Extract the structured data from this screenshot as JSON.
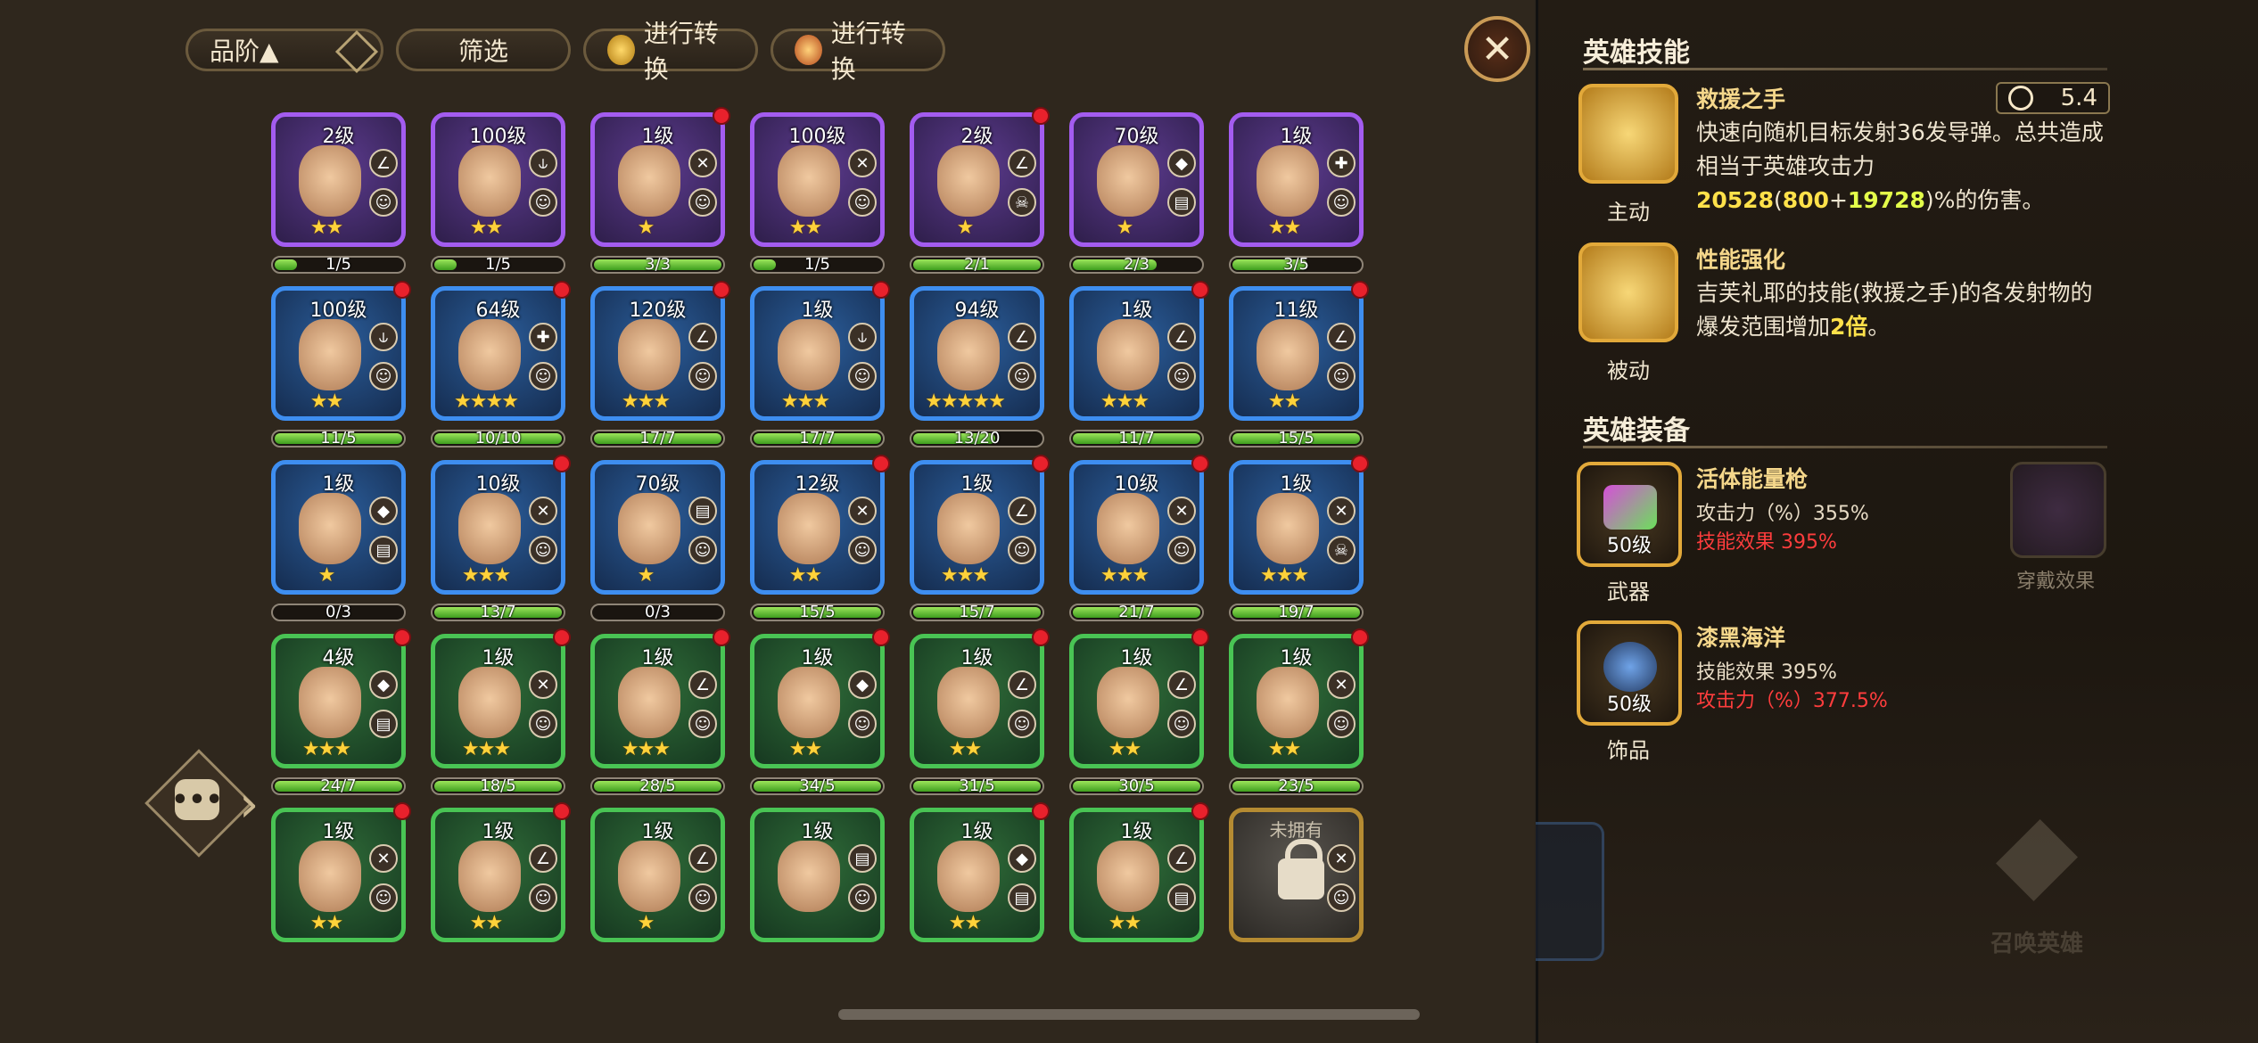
{
  "toolbar": {
    "sort_label": "品阶▲",
    "filter_label": "筛选",
    "convert1_label": "进行转换",
    "convert2_label": "进行转换"
  },
  "close_label": "✕",
  "heroes": [
    [
      {
        "level": "2级",
        "rarity": "purple",
        "stars": "★★",
        "progress": "1/5",
        "fill": 0.2,
        "dot": false,
        "badges": [
          "∠",
          "☺"
        ]
      },
      {
        "level": "100级",
        "rarity": "purple",
        "stars": "★★",
        "progress": "1/5",
        "fill": 0.2,
        "dot": false,
        "badges": [
          "⫝",
          "☺"
        ]
      },
      {
        "level": "1级",
        "rarity": "purple",
        "stars": "★",
        "progress": "3/3",
        "fill": 1.0,
        "dot": true,
        "badges": [
          "✕",
          "☺"
        ]
      },
      {
        "level": "100级",
        "rarity": "purple",
        "stars": "★★",
        "progress": "1/5",
        "fill": 0.2,
        "dot": false,
        "badges": [
          "✕",
          "☺"
        ]
      },
      {
        "level": "2级",
        "rarity": "purple",
        "stars": "★",
        "progress": "2/1",
        "fill": 1.0,
        "dot": true,
        "badges": [
          "∠",
          "☠"
        ]
      },
      {
        "level": "70级",
        "rarity": "purple",
        "stars": "★",
        "progress": "2/3",
        "fill": 0.67,
        "dot": false,
        "badges": [
          "◆",
          "▤"
        ]
      },
      {
        "level": "1级",
        "rarity": "purple",
        "stars": "★★",
        "progress": "3/5",
        "fill": 0.6,
        "dot": false,
        "badges": [
          "✚",
          "☺"
        ]
      }
    ],
    [
      {
        "level": "100级",
        "rarity": "blue",
        "stars": "★★",
        "progress": "11/5",
        "fill": 1.0,
        "dot": true,
        "badges": [
          "⫝",
          "☺"
        ]
      },
      {
        "level": "64级",
        "rarity": "blue",
        "stars": "★★★★",
        "progress": "10/10",
        "fill": 1.0,
        "dot": true,
        "badges": [
          "✚",
          "☺"
        ]
      },
      {
        "level": "120级",
        "rarity": "blue",
        "stars": "★★★",
        "progress": "17/7",
        "fill": 1.0,
        "dot": true,
        "badges": [
          "∠",
          "☺"
        ]
      },
      {
        "level": "1级",
        "rarity": "blue",
        "stars": "★★★",
        "progress": "17/7",
        "fill": 1.0,
        "dot": true,
        "badges": [
          "⫝",
          "☺"
        ]
      },
      {
        "level": "94级",
        "rarity": "blue",
        "stars": "★★★★★",
        "progress": "13/20",
        "fill": 0.65,
        "dot": false,
        "badges": [
          "∠",
          "☺"
        ]
      },
      {
        "level": "1级",
        "rarity": "blue",
        "stars": "★★★",
        "progress": "11/7",
        "fill": 1.0,
        "dot": true,
        "badges": [
          "∠",
          "☺"
        ]
      },
      {
        "level": "11级",
        "rarity": "blue",
        "stars": "★★",
        "progress": "15/5",
        "fill": 1.0,
        "dot": true,
        "badges": [
          "∠",
          "☺"
        ]
      }
    ],
    [
      {
        "level": "1级",
        "rarity": "blue",
        "stars": "★",
        "progress": "0/3",
        "fill": 0.0,
        "dot": false,
        "badges": [
          "◆",
          "▤"
        ]
      },
      {
        "level": "10级",
        "rarity": "blue",
        "stars": "★★★",
        "progress": "13/7",
        "fill": 1.0,
        "dot": true,
        "badges": [
          "✕",
          "☺"
        ]
      },
      {
        "level": "70级",
        "rarity": "blue",
        "stars": "★",
        "progress": "0/3",
        "fill": 0.0,
        "dot": false,
        "badges": [
          "▤",
          "☺"
        ]
      },
      {
        "level": "12级",
        "rarity": "blue",
        "stars": "★★",
        "progress": "15/5",
        "fill": 1.0,
        "dot": true,
        "badges": [
          "✕",
          "☺"
        ]
      },
      {
        "level": "1级",
        "rarity": "blue",
        "stars": "★★★",
        "progress": "15/7",
        "fill": 1.0,
        "dot": true,
        "badges": [
          "∠",
          "☺"
        ]
      },
      {
        "level": "10级",
        "rarity": "blue",
        "stars": "★★★",
        "progress": "21/7",
        "fill": 1.0,
        "dot": true,
        "badges": [
          "✕",
          "☺"
        ]
      },
      {
        "level": "1级",
        "rarity": "blue",
        "stars": "★★★",
        "progress": "19/7",
        "fill": 1.0,
        "dot": true,
        "badges": [
          "✕",
          "☠"
        ]
      }
    ],
    [
      {
        "level": "4级",
        "rarity": "green",
        "stars": "★★★",
        "progress": "24/7",
        "fill": 1.0,
        "dot": true,
        "badges": [
          "◆",
          "▤"
        ]
      },
      {
        "level": "1级",
        "rarity": "green",
        "stars": "★★★",
        "progress": "18/5",
        "fill": 1.0,
        "dot": true,
        "badges": [
          "✕",
          "☺"
        ]
      },
      {
        "level": "1级",
        "rarity": "green",
        "stars": "★★★",
        "progress": "28/5",
        "fill": 1.0,
        "dot": true,
        "badges": [
          "∠",
          "☺"
        ]
      },
      {
        "level": "1级",
        "rarity": "green",
        "stars": "★★",
        "progress": "34/5",
        "fill": 1.0,
        "dot": true,
        "badges": [
          "◆",
          "☺"
        ]
      },
      {
        "level": "1级",
        "rarity": "green",
        "stars": "★★",
        "progress": "31/5",
        "fill": 1.0,
        "dot": true,
        "badges": [
          "∠",
          "☺"
        ]
      },
      {
        "level": "1级",
        "rarity": "green",
        "stars": "★★",
        "progress": "30/5",
        "fill": 1.0,
        "dot": true,
        "badges": [
          "∠",
          "☺"
        ]
      },
      {
        "level": "1级",
        "rarity": "green",
        "stars": "★★",
        "progress": "23/5",
        "fill": 1.0,
        "dot": true,
        "badges": [
          "✕",
          "☺"
        ]
      }
    ],
    [
      {
        "level": "1级",
        "rarity": "green",
        "stars": "★★",
        "progress": "",
        "fill": 0,
        "dot": true,
        "badges": [
          "✕",
          "☺"
        ]
      },
      {
        "level": "1级",
        "rarity": "green",
        "stars": "★★",
        "progress": "",
        "fill": 0,
        "dot": true,
        "badges": [
          "∠",
          "☺"
        ]
      },
      {
        "level": "1级",
        "rarity": "green",
        "stars": "★",
        "progress": "",
        "fill": 0,
        "dot": false,
        "badges": [
          "∠",
          "☺"
        ]
      },
      {
        "level": "1级",
        "rarity": "green",
        "stars": "",
        "progress": "",
        "fill": 0,
        "dot": false,
        "badges": [
          "▤",
          "☺"
        ]
      },
      {
        "level": "1级",
        "rarity": "green",
        "stars": "★★",
        "progress": "",
        "fill": 0,
        "dot": true,
        "badges": [
          "◆",
          "▤"
        ]
      },
      {
        "level": "1级",
        "rarity": "green",
        "stars": "★★",
        "progress": "",
        "fill": 0,
        "dot": true,
        "badges": [
          "∠",
          "▤"
        ]
      },
      {
        "level": "未拥有",
        "rarity": "locked",
        "stars": "",
        "progress": "",
        "fill": 0,
        "dot": false,
        "badges": [
          "✕",
          "☺"
        ]
      }
    ]
  ],
  "panel": {
    "skill_title": "英雄技能",
    "skill1": {
      "name": "救援之手",
      "cooldown": "5.4",
      "type": "主动",
      "desc_pre": "快速向随机目标发射36发导弹。总共造成相当于英雄攻击力",
      "desc_value": "20528",
      "desc_open": "(",
      "desc_base": "800",
      "desc_plus": "+",
      "desc_bonus": "19728",
      "desc_post": ")%的伤害。"
    },
    "skill2": {
      "name": "性能强化",
      "type": "被动",
      "desc": "吉芙礼耶的技能(救援之手)的各发射物的爆发范围增加",
      "desc_value": "2倍",
      "desc_post": "。"
    },
    "equip_title": "英雄装备",
    "weapon": {
      "name": "活体能量枪",
      "level": "50级",
      "slot": "武器",
      "stat1": "攻击力（%）355%",
      "stat2": "技能效果 395%"
    },
    "wear_label": "穿戴效果",
    "accessory": {
      "name": "漆黑海洋",
      "level": "50级",
      "slot": "饰品",
      "stat1": "技能效果 395%",
      "stat2": "攻击力（%）377.5%"
    },
    "summon_label": "召唤英雄"
  },
  "colors": {
    "purple": "#a35cf0",
    "blue": "#3e8ef0",
    "green": "#49c454",
    "gold": "#e2a93a",
    "red_stat": "#ff3d3d"
  }
}
